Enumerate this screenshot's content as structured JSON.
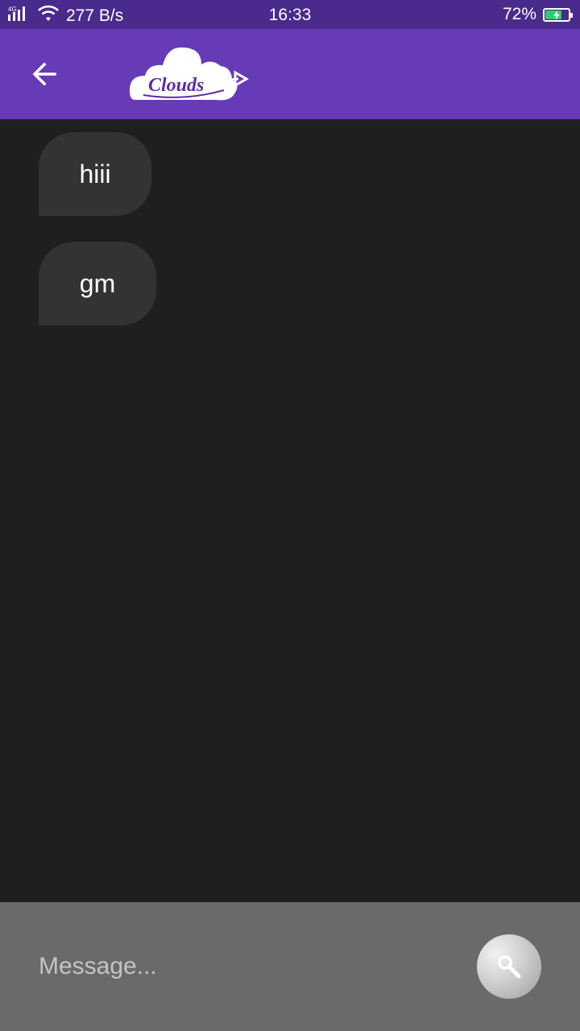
{
  "status_bar": {
    "network_type": "4G",
    "speed": "277 B/s",
    "time": "16:33",
    "battery_percent": "72%",
    "battery_level": 0.72,
    "battery_color": "#2ecc71",
    "background": "#4a2a8c"
  },
  "app_bar": {
    "background": "#673ab7",
    "back_icon": "arrow-back-icon",
    "logo_text": "Clouds"
  },
  "messages": [
    {
      "text": "hiii"
    },
    {
      "text": "gm"
    }
  ],
  "composer": {
    "placeholder": "Message...",
    "value": "",
    "send_icon": "search-icon"
  }
}
